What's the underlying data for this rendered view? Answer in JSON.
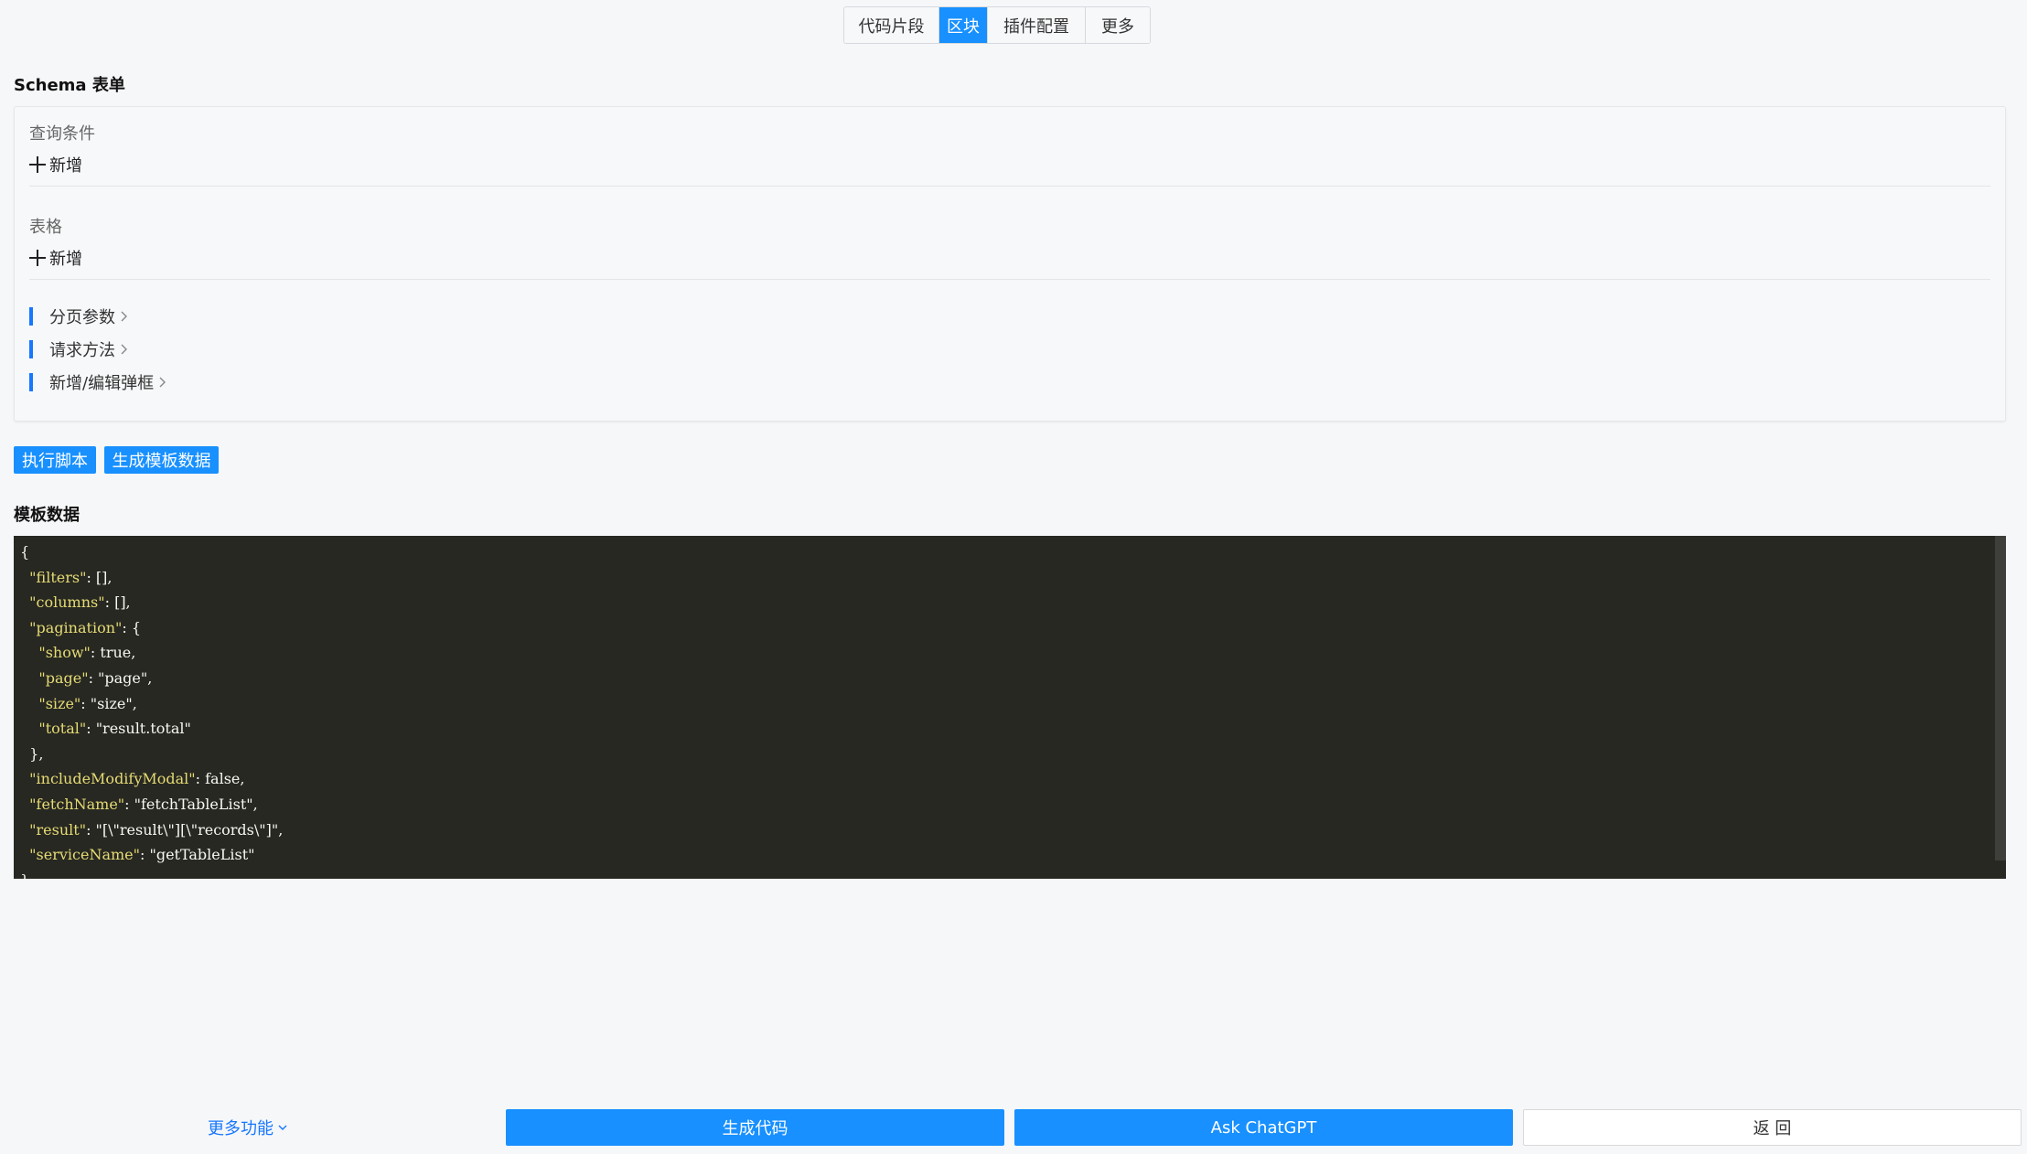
{
  "tabs": [
    {
      "label": "代码片段",
      "active": false
    },
    {
      "label": "区块",
      "active": true
    },
    {
      "label": "插件配置",
      "active": false
    },
    {
      "label": "更多",
      "active": false
    }
  ],
  "schema_form": {
    "title": "Schema 表单",
    "groups": [
      {
        "label": "查询条件",
        "add_label": "新增"
      },
      {
        "label": "表格",
        "add_label": "新增"
      }
    ],
    "config_items": [
      "分页参数",
      "请求方法",
      "新增/编辑弹框"
    ]
  },
  "actions": {
    "run_script": "执行脚本",
    "generate_template": "生成模板数据"
  },
  "template_data": {
    "title": "模板数据",
    "code": {
      "filters": [],
      "columns": [],
      "pagination": {
        "show": true,
        "page": "page",
        "size": "size",
        "total": "result.total"
      },
      "includeModifyModal": false,
      "fetchName": "fetchTableList",
      "result": "[\"result\"][\"records\"]",
      "serviceName": "getTableList"
    }
  },
  "footer": {
    "more_label": "更多功能",
    "generate_code": "生成代码",
    "ask_chatgpt": "Ask ChatGPT",
    "back": "返 回"
  },
  "colors": {
    "primary": "#1890ff",
    "editor_bg": "#272822",
    "accent_bar": "#1677ff"
  }
}
